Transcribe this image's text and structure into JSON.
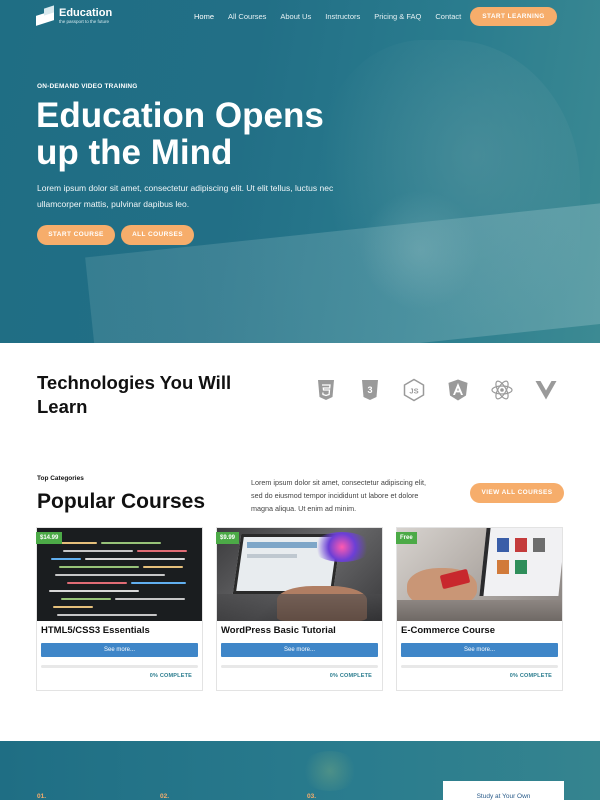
{
  "header": {
    "logo_text": "Education",
    "logo_tagline": "the passport to the future",
    "nav": [
      "Home",
      "All Courses",
      "About Us",
      "Instructors",
      "Pricing & FAQ",
      "Contact"
    ],
    "cta": "START LEARNING"
  },
  "hero": {
    "eyebrow": "ON-DEMAND VIDEO TRAINING",
    "title": "Education Opens up the Mind",
    "text": "Lorem ipsum dolor sit amet, consectetur adipiscing elit. Ut elit tellus, luctus nec ullamcorper mattis, pulvinar dapibus leo.",
    "btn_start": "START COURSE",
    "btn_all": "ALL COURSES"
  },
  "tech": {
    "title": "Technologies You Will Learn",
    "icons": [
      "html5-icon",
      "css3-icon",
      "nodejs-icon",
      "angular-icon",
      "react-icon",
      "vue-icon"
    ]
  },
  "courses": {
    "category": "Top Categories",
    "title": "Popular Courses",
    "description": "Lorem ipsum dolor sit amet, consectetur adipiscing elit, sed do eiusmod tempor incididunt ut labore et dolore magna aliqua. Ut enim ad minim.",
    "view_all": "VIEW ALL COURSES",
    "items": [
      {
        "price": "$14.99",
        "title": "HTML5/CSS3 Essentials",
        "button": "See more...",
        "progress": "0% COMPLETE"
      },
      {
        "price": "$9.99",
        "title": "WordPress Basic Tutorial",
        "button": "See more...",
        "progress": "0% COMPLETE"
      },
      {
        "price": "Free",
        "title": "E-Commerce Course",
        "button": "See more...",
        "progress": "0% COMPLETE"
      }
    ]
  },
  "steps": {
    "items": [
      "01.",
      "02.",
      "03."
    ],
    "study_label": "Study at Your Own"
  },
  "colors": {
    "brand_teal": "#226f86",
    "accent_orange": "#f6ad6b",
    "button_blue": "#3f86c8",
    "price_green": "#4caa47"
  }
}
